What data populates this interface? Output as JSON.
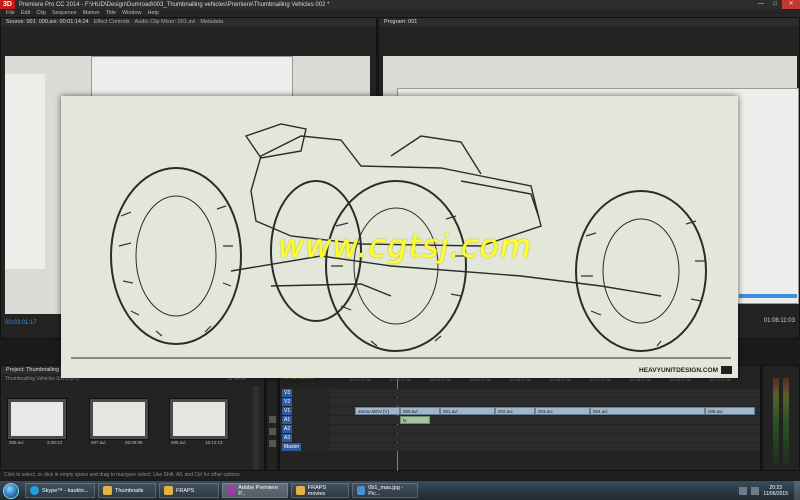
{
  "app": {
    "logo_text": "3D",
    "title": "Premiere Pro CC 2014 - F:\\HUD\\Design\\Dumroad\\003_Thumbnailing vehicles\\Premiere\\Thumbnailing Vehicles 002 *"
  },
  "menu": [
    "File",
    "Edit",
    "Clip",
    "Sequence",
    "Marker",
    "Title",
    "Window",
    "Help"
  ],
  "source_panel": {
    "tabs": [
      "Source: 001: 000.avi: 00:01:14:24",
      "Effect Controls",
      "Audio Clip Mixer: 001.avi",
      "Metadata"
    ],
    "timecode": "00:03:01:17"
  },
  "program_panel": {
    "tab": "Program: 001",
    "timecode": "01:08:11:03"
  },
  "overlay": {
    "watermark": "www.cgtsj.com",
    "brand": "HEAVYUNITDESIGN.COM"
  },
  "project_panel": {
    "title": "Project: Thumbnailing Vehicles 002",
    "file": "Thumbnailing Vehicles 002.prproj",
    "item_count": "31 Items",
    "thumbs": [
      {
        "name": "006.avi",
        "duration": "3:28:13"
      },
      {
        "name": "007.avi",
        "duration": "26:09:06"
      },
      {
        "name": "005.avi",
        "duration": "16:12:13"
      }
    ]
  },
  "timeline": {
    "timecode": "00:03:01:00",
    "ruler": [
      "00:01:00:00",
      "00:02:00:00",
      "00:03:00:00",
      "00:04:00:00",
      "00:05:00:00",
      "00:06:00:00",
      "00:07:00:00",
      "00:08:00:00",
      "00:09:00:00",
      "00:10:00:00"
    ],
    "tracks": [
      {
        "id": "V3"
      },
      {
        "id": "V2"
      },
      {
        "id": "V1"
      },
      {
        "id": "A1"
      },
      {
        "id": "A2"
      },
      {
        "id": "A3"
      },
      {
        "id": "Master"
      }
    ],
    "video_clips": [
      "ammo.MOV [V]",
      "000.avi",
      "001.avi",
      "002.avi",
      "003.avi",
      "004.avi",
      "005.avi"
    ],
    "audio_clips": [
      "fx"
    ]
  },
  "status_bar": "Click to select, or click in empty space and drag to marquee select. Use Shift, Alt, and Ctrl for other options.",
  "taskbar": {
    "tasks": [
      {
        "label": "Skype™ - kaukto...",
        "color": "#1fa0e0"
      },
      {
        "label": "Thumbnails",
        "color": "#e3b341"
      },
      {
        "label": "FRAPS",
        "color": "#e3b341"
      },
      {
        "label": "Adobe Premiere P...",
        "color": "#9b3aa8"
      },
      {
        "label": "FRAPS movies",
        "color": "#e3b341"
      },
      {
        "label": "0b1_mas.jpg - Pic...",
        "color": "#4a8fd0"
      }
    ],
    "time": "20:23",
    "date": "11/06/2015"
  }
}
